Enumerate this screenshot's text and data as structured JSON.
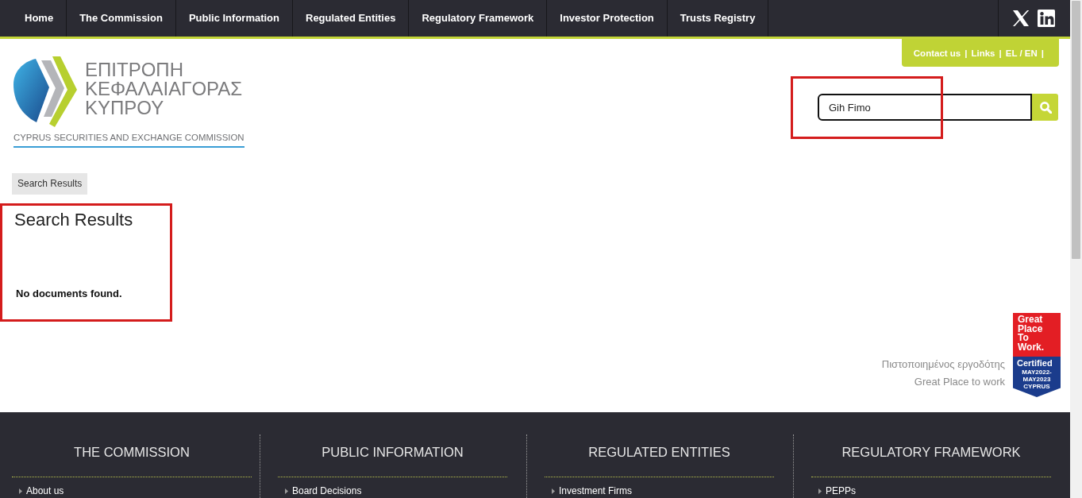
{
  "nav": {
    "items": [
      {
        "label": "Home",
        "selected": false
      },
      {
        "label": "The Commission",
        "selected": false
      },
      {
        "label": "Public Information",
        "selected": false
      },
      {
        "label": "Regulated Entities",
        "selected": false
      },
      {
        "label": "Regulatory Framework",
        "selected": false
      },
      {
        "label": "Investor Protection",
        "selected": false
      },
      {
        "label": "Trusts Registry",
        "selected": false
      }
    ],
    "social": [
      {
        "kind": "x"
      },
      {
        "kind": "linkedin"
      }
    ]
  },
  "top_links": {
    "items": [
      "Contact us",
      "Links",
      "EL / EN"
    ],
    "separator": "|"
  },
  "logo": {
    "lines": [
      "ΕΠΙΤΡΟΠΗ",
      "ΚΕΦΑΛΑΙΑΓΟΡΑΣ",
      "ΚΥΠΡΟΥ"
    ],
    "subtitle": "CYPRUS SECURITIES AND EXCHANGE COMMISSION"
  },
  "search": {
    "value": "Gih Fimo",
    "highlighted": true
  },
  "breadcrumb": [
    "Search Results"
  ],
  "results": {
    "title": "Search Results",
    "message": "No documents found.",
    "highlighted": true
  },
  "certification": {
    "lines": [
      "Πιστοποιημένος εργοδότης",
      "Great Place to work"
    ],
    "badge": {
      "title": "Great Place To Work.",
      "label": "Certified",
      "dates": "MAY2022-MAY2023",
      "country": "CYPRUS"
    }
  },
  "footer": {
    "columns": [
      {
        "title": "THE COMMISSION",
        "links": [
          "About us"
        ]
      },
      {
        "title": "PUBLIC INFORMATION",
        "links": [
          "Board Decisions"
        ]
      },
      {
        "title": "REGULATED ENTITIES",
        "links": [
          "Investment Firms"
        ]
      },
      {
        "title": "REGULATORY FRAMEWORK",
        "links": [
          "PEPPs"
        ]
      }
    ]
  }
}
